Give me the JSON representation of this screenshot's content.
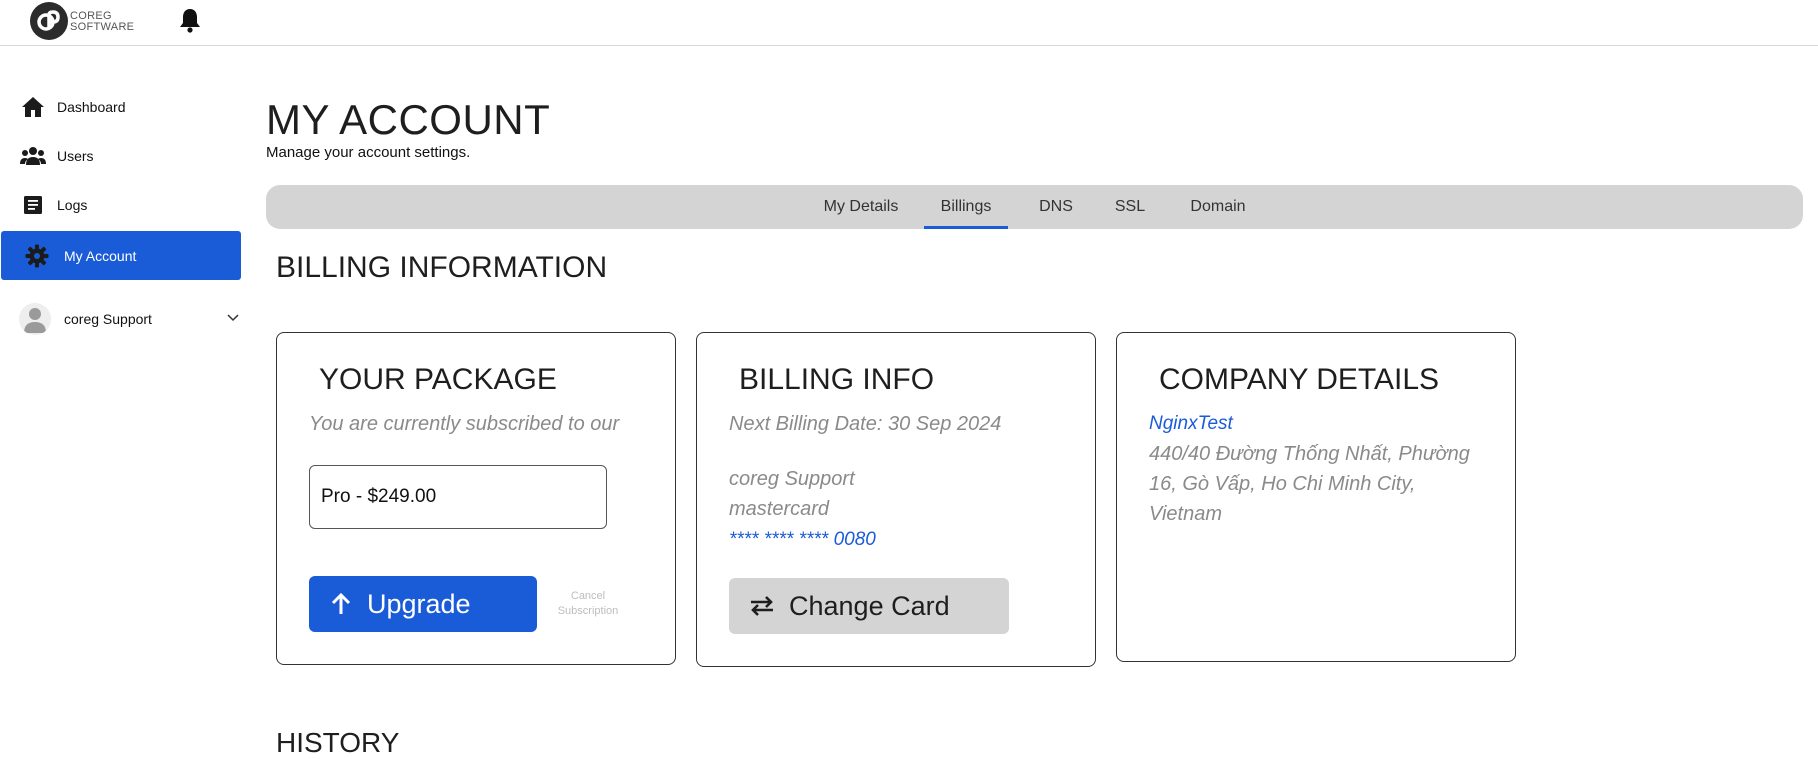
{
  "brand": {
    "line1": "COREG",
    "line2": "SOFTWARE"
  },
  "sidebar": {
    "items": [
      {
        "label": "Dashboard",
        "icon": "home-icon"
      },
      {
        "label": "Users",
        "icon": "users-icon"
      },
      {
        "label": "Logs",
        "icon": "logs-icon"
      },
      {
        "label": "My Account",
        "icon": "gear-icon",
        "active": true
      }
    ],
    "user": {
      "name": "coreg Support"
    }
  },
  "page": {
    "title": "MY ACCOUNT",
    "subtitle": "Manage your account settings."
  },
  "tabs": [
    {
      "label": "My Details"
    },
    {
      "label": "Billings",
      "active": true
    },
    {
      "label": "DNS"
    },
    {
      "label": "SSL"
    },
    {
      "label": "Domain"
    }
  ],
  "billing": {
    "section_title": "BILLING INFORMATION",
    "package": {
      "title": "YOUR PACKAGE",
      "description": "You are currently subscribed to our",
      "plan": "Pro - $249.00",
      "upgrade_label": "Upgrade",
      "cancel_label": "Cancel Subscription"
    },
    "info": {
      "title": "BILLING INFO",
      "next_billing": "Next Billing Date: 30 Sep 2024",
      "card_holder": "coreg Support",
      "card_type": "mastercard",
      "card_number": "**** **** **** 0080",
      "change_label": "Change Card"
    },
    "company": {
      "title": "COMPANY DETAILS",
      "name": "NginxTest",
      "address": "440/40 Đường Thống Nhất, Phường 16, Gò Vấp, Ho Chi Minh City, Vietnam"
    }
  },
  "history": {
    "title": "HISTORY"
  },
  "colors": {
    "accent": "#1a5cd7",
    "tabbar": "#d4d4d4",
    "muted": "#8a8a8a"
  }
}
